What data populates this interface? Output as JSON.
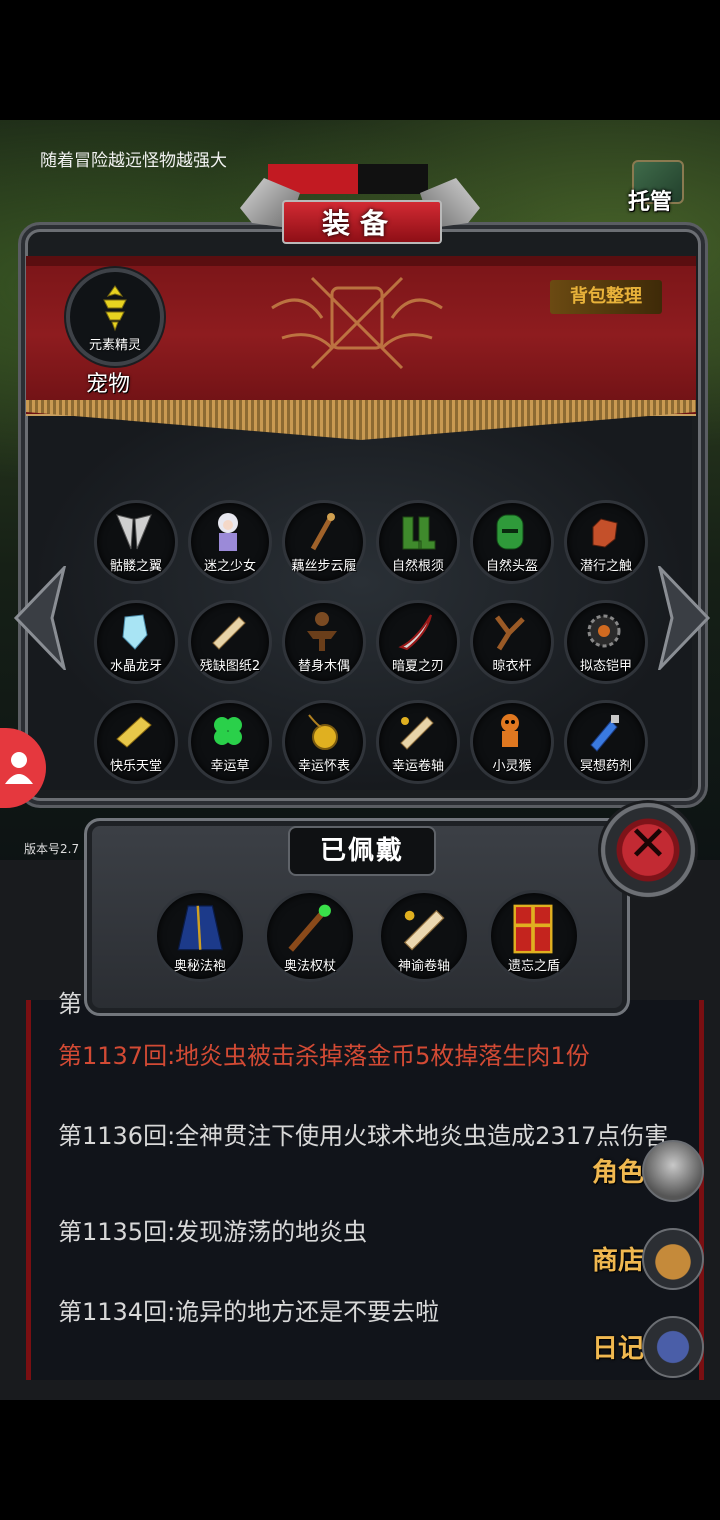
{
  "top_hint": "随着冒险越远怪物越强大",
  "tuoguan_label": "托管",
  "panel_title": "装备",
  "sort_label": "背包整理",
  "pet": {
    "label": "宠物",
    "name": "元素精灵"
  },
  "inventory": [
    {
      "name": "骷髅之翼",
      "icon": "bone-wings-icon"
    },
    {
      "name": "迷之少女",
      "icon": "girl-icon"
    },
    {
      "name": "藕丝步云履",
      "icon": "staff-icon"
    },
    {
      "name": "自然根须",
      "icon": "green-boots-icon"
    },
    {
      "name": "自然头盔",
      "icon": "green-helmet-icon"
    },
    {
      "name": "潜行之触",
      "icon": "glove-icon"
    },
    {
      "name": "水晶龙牙",
      "icon": "crystal-icon"
    },
    {
      "name": "残缺图纸2",
      "icon": "scroll-icon"
    },
    {
      "name": "替身木偶",
      "icon": "wood-puppet-icon"
    },
    {
      "name": "暗夏之刃",
      "icon": "blade-icon"
    },
    {
      "name": "晾衣杆",
      "icon": "slingshot-icon"
    },
    {
      "name": "拟态铠甲",
      "icon": "armor-icon"
    },
    {
      "name": "快乐天堂",
      "icon": "book-icon"
    },
    {
      "name": "幸运草",
      "icon": "clover-icon"
    },
    {
      "name": "幸运怀表",
      "icon": "pocket-watch-icon"
    },
    {
      "name": "幸运卷轴",
      "icon": "scroll-icon"
    },
    {
      "name": "小灵猴",
      "icon": "monkey-icon"
    },
    {
      "name": "冥想药剂",
      "icon": "potion-icon"
    }
  ],
  "worn_title": "已佩戴",
  "worn": [
    {
      "name": "奥秘法袍",
      "icon": "robe-icon"
    },
    {
      "name": "奥法权杖",
      "icon": "scepter-icon"
    },
    {
      "name": "神谕卷轴",
      "icon": "scroll-icon"
    },
    {
      "name": "遗忘之盾",
      "icon": "shield-icon"
    }
  ],
  "version": "版本号2.7",
  "log_partial": "第",
  "log": [
    {
      "text": "第1137回:地炎虫被击杀掉落金币5枚掉落生肉1份",
      "highlight": true
    },
    {
      "text": "第1136回:全神贯注下使用火球术地炎虫造成2317点伤害",
      "highlight": false
    },
    {
      "text": "第1135回:发现游荡的地炎虫",
      "highlight": false
    },
    {
      "text": "第1134回:诡异的地方还是不要去啦",
      "highlight": false
    }
  ],
  "side_menu": [
    {
      "label": "角色",
      "icon": "knight-helmet-icon"
    },
    {
      "label": "商店",
      "icon": "beer-mug-icon"
    },
    {
      "label": "日记",
      "icon": "diary-icon"
    }
  ]
}
